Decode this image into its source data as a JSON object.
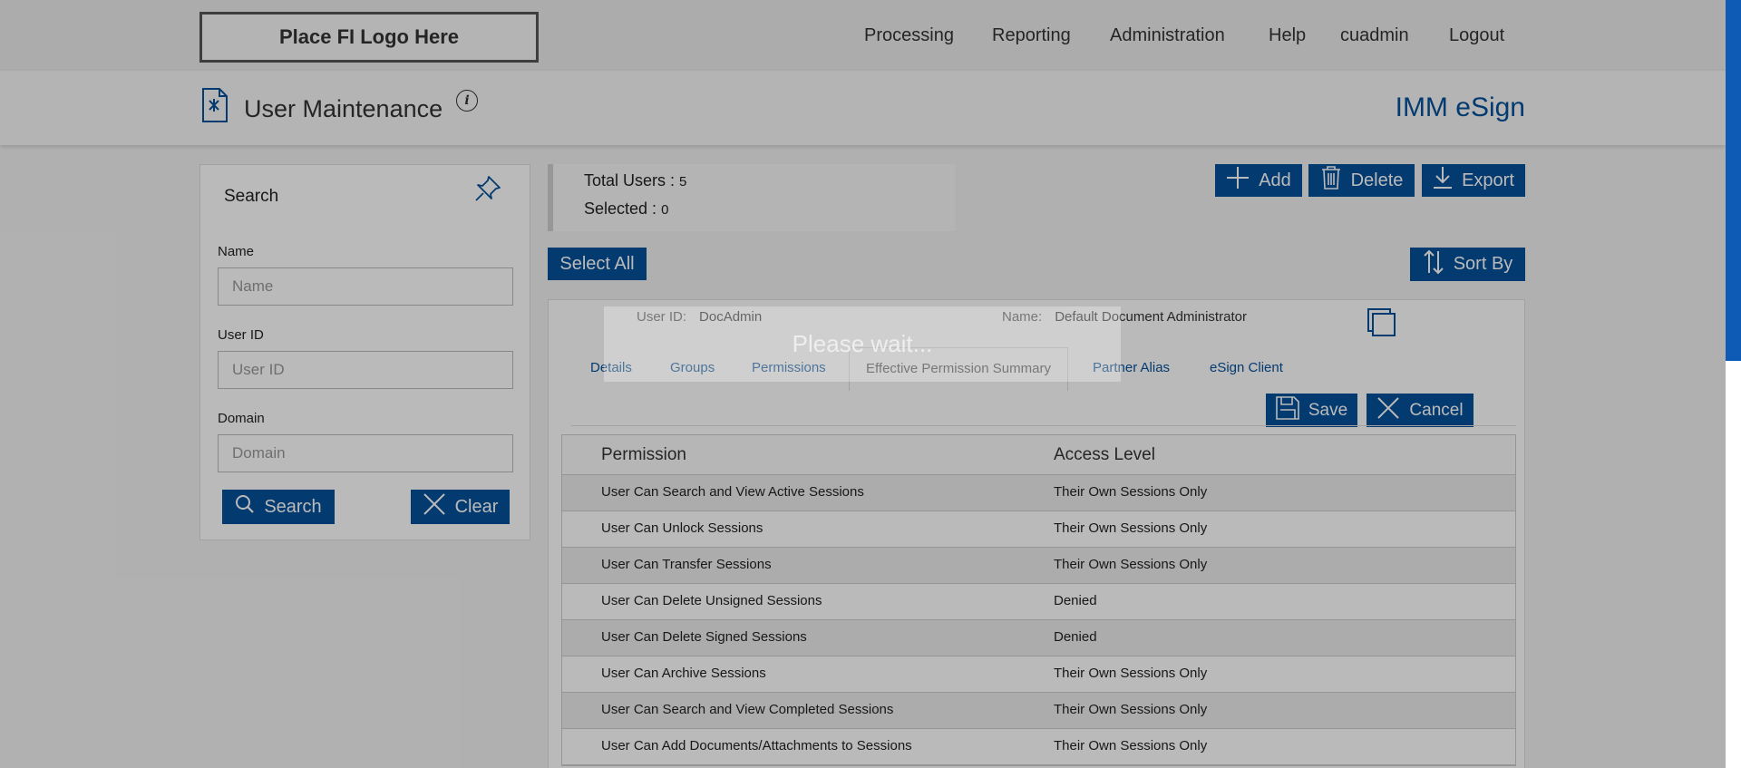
{
  "logo": {
    "text": "Place FI Logo Here"
  },
  "nav": {
    "items": [
      {
        "label": "Processing"
      },
      {
        "label": "Reporting"
      },
      {
        "label": "Administration"
      },
      {
        "label": "Help"
      },
      {
        "label": "cuadmin"
      },
      {
        "label": "Logout"
      }
    ]
  },
  "header": {
    "title": "User Maintenance",
    "info_icon": "i",
    "app_name": "IMM eSign"
  },
  "search": {
    "title": "Search",
    "name_label": "Name",
    "name_placeholder": "Name",
    "userid_label": "User ID",
    "userid_placeholder": "User ID",
    "domain_label": "Domain",
    "domain_placeholder": "Domain",
    "search_button": "Search",
    "clear_button": "Clear"
  },
  "summary": {
    "total_label": "Total Users :",
    "total_value": "5",
    "selected_label": "Selected :",
    "selected_value": "0"
  },
  "toolbar": {
    "add": "Add",
    "delete": "Delete",
    "export": "Export",
    "select_all": "Select All",
    "sort_by": "Sort By"
  },
  "user": {
    "userid_label": "User ID:",
    "userid_value": "DocAdmin",
    "name_label": "Name:",
    "name_value": "Default Document Administrator"
  },
  "tabs": [
    {
      "label": "Details"
    },
    {
      "label": "Groups"
    },
    {
      "label": "Permissions"
    },
    {
      "label": "Effective Permission Summary"
    },
    {
      "label": "Partner Alias"
    },
    {
      "label": "eSign Client"
    }
  ],
  "actions": {
    "save": "Save",
    "cancel": "Cancel"
  },
  "permissions": {
    "headers": {
      "permission": "Permission",
      "access": "Access Level"
    },
    "rows": [
      {
        "permission": "User Can Search and View Active Sessions",
        "access": "Their Own Sessions Only"
      },
      {
        "permission": "User Can Unlock Sessions",
        "access": "Their Own Sessions Only"
      },
      {
        "permission": "User Can Transfer Sessions",
        "access": "Their Own Sessions Only"
      },
      {
        "permission": "User Can Delete Unsigned Sessions",
        "access": "Denied"
      },
      {
        "permission": "User Can Delete Signed Sessions",
        "access": "Denied"
      },
      {
        "permission": "User Can Archive Sessions",
        "access": "Their Own Sessions Only"
      },
      {
        "permission": "User Can Search and View Completed Sessions",
        "access": "Their Own Sessions Only"
      },
      {
        "permission": "User Can Add Documents/Attachments to Sessions",
        "access": "Their Own Sessions Only"
      }
    ]
  },
  "overlay": {
    "message": "Please wait..."
  },
  "colors": {
    "accent": "#05509a",
    "scrollbar": "#0d5bb5"
  }
}
